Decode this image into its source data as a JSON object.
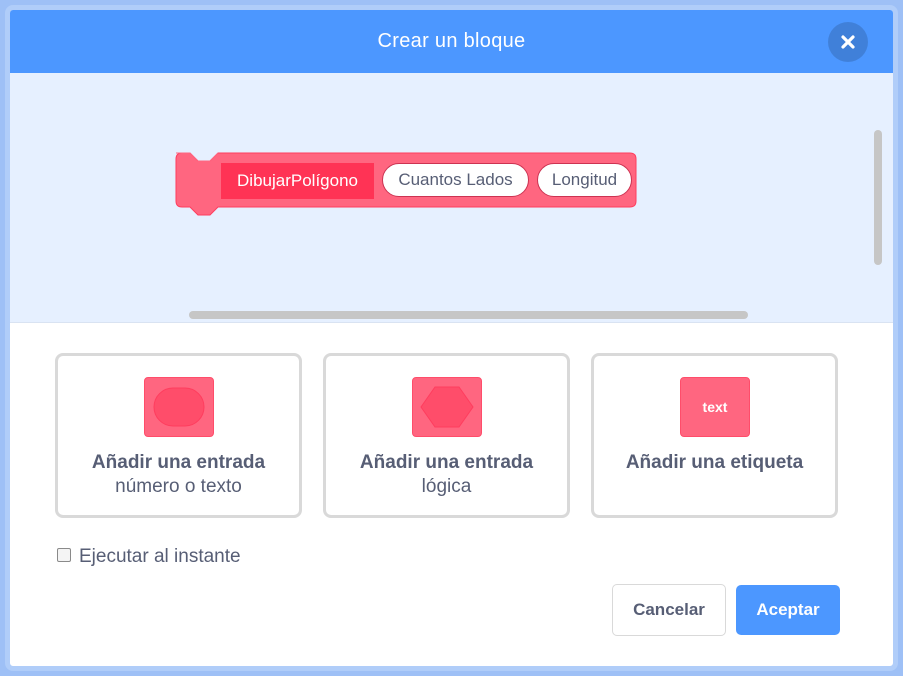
{
  "modal": {
    "title": "Crear un bloque",
    "close_icon": "close-icon"
  },
  "block": {
    "name": "DibujarPolígono",
    "inputs": [
      "Cuantos Lados",
      "Longitud"
    ],
    "color": "#ff6680"
  },
  "options": [
    {
      "title": "Añadir una entrada",
      "subtitle": "número o texto",
      "icon": "round-input-icon"
    },
    {
      "title": "Añadir una entrada",
      "subtitle": "lógica",
      "icon": "boolean-input-icon"
    },
    {
      "title": "Añadir una etiqueta",
      "subtitle": "",
      "icon": "label-icon",
      "icon_text": "text"
    }
  ],
  "run_without_refresh": {
    "label": "Ejecutar al instante",
    "checked": false
  },
  "buttons": {
    "cancel": "Cancelar",
    "ok": "Aceptar"
  },
  "colors": {
    "header": "#4c97ff",
    "accent": "#4c97ff",
    "block": "#ff6680",
    "text": "#575e75"
  }
}
